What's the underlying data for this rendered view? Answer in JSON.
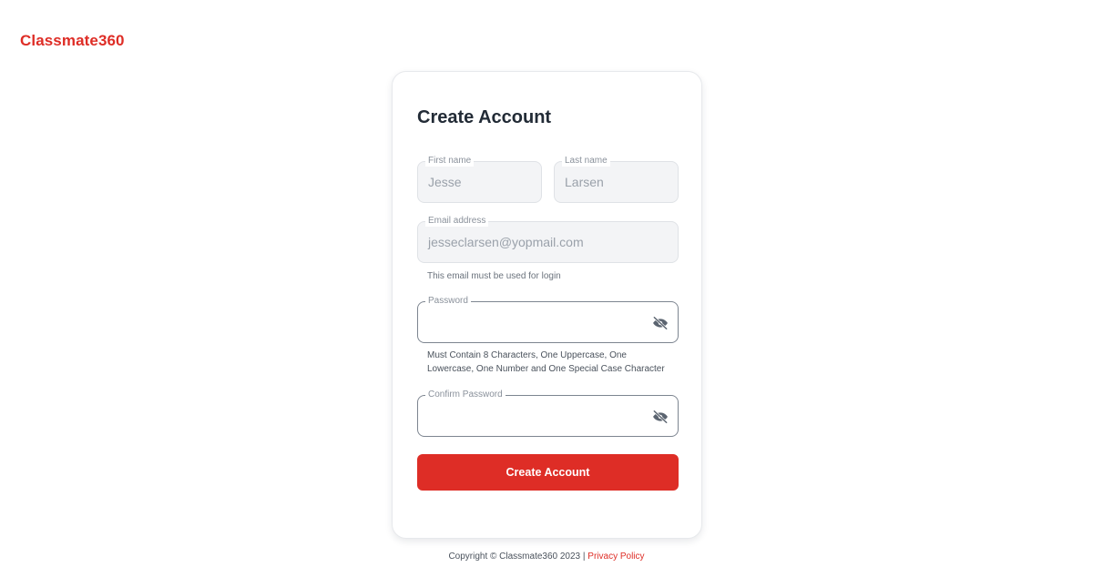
{
  "brand": {
    "name": "Classmate360",
    "color": "#de2d26"
  },
  "form": {
    "title": "Create Account",
    "first_name": {
      "label": "First name",
      "value": "Jesse"
    },
    "last_name": {
      "label": "Last name",
      "value": "Larsen"
    },
    "email": {
      "label": "Email address",
      "value": "jesseclarsen@yopmail.com",
      "helper": "This email must be used for login"
    },
    "password": {
      "label": "Password",
      "value": "",
      "helper_line1": "Must Contain 8 Characters, One Uppercase, One",
      "helper_line2": "Lowercase, One Number and One Special Case Character",
      "toggle_icon": "eye-off-icon"
    },
    "confirm_password": {
      "label": "Confirm Password",
      "value": "",
      "toggle_icon": "eye-off-icon"
    },
    "submit_label": "Create Account"
  },
  "footer": {
    "copyright": "Copyright © Classmate360 2023 | ",
    "privacy_link": "Privacy Policy"
  }
}
